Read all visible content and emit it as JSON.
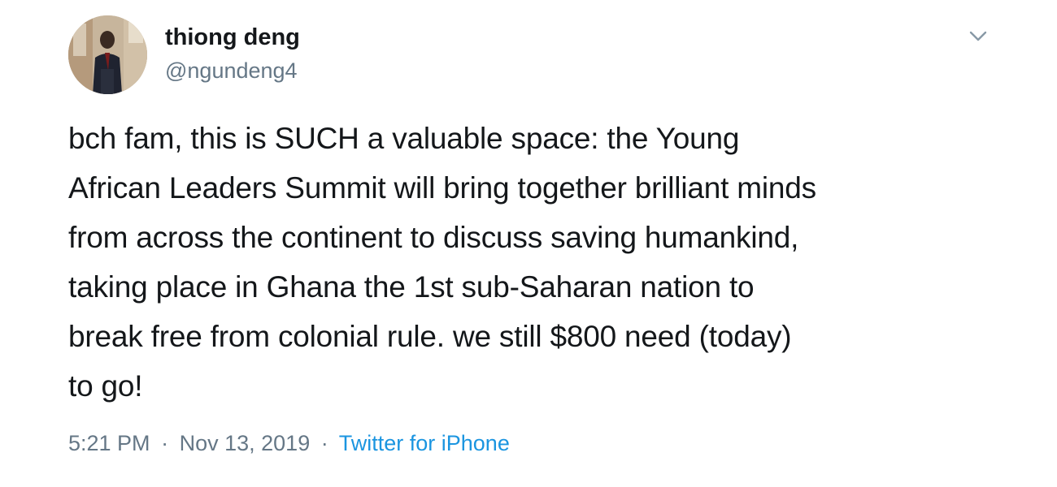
{
  "tweet": {
    "author": {
      "display_name": "thiong deng",
      "handle": "@ngundeng4"
    },
    "text_lines": [
      "bch fam, this is SUCH a valuable space: the Young",
      "African Leaders Summit will bring together brilliant minds",
      "from across the continent to discuss saving humankind,",
      "taking place in Ghana the 1st sub-Saharan nation to",
      "break free from colonial rule. we still $800 need (today)",
      "to go!"
    ],
    "time": "5:21 PM",
    "date": "Nov 13, 2019",
    "separator": "·",
    "source": "Twitter for iPhone",
    "icons": {
      "menu": "chevron-down-icon",
      "avatar": "avatar-photo"
    },
    "colors": {
      "text": "#14171a",
      "secondary": "#657786",
      "link": "#1b95e0"
    }
  }
}
